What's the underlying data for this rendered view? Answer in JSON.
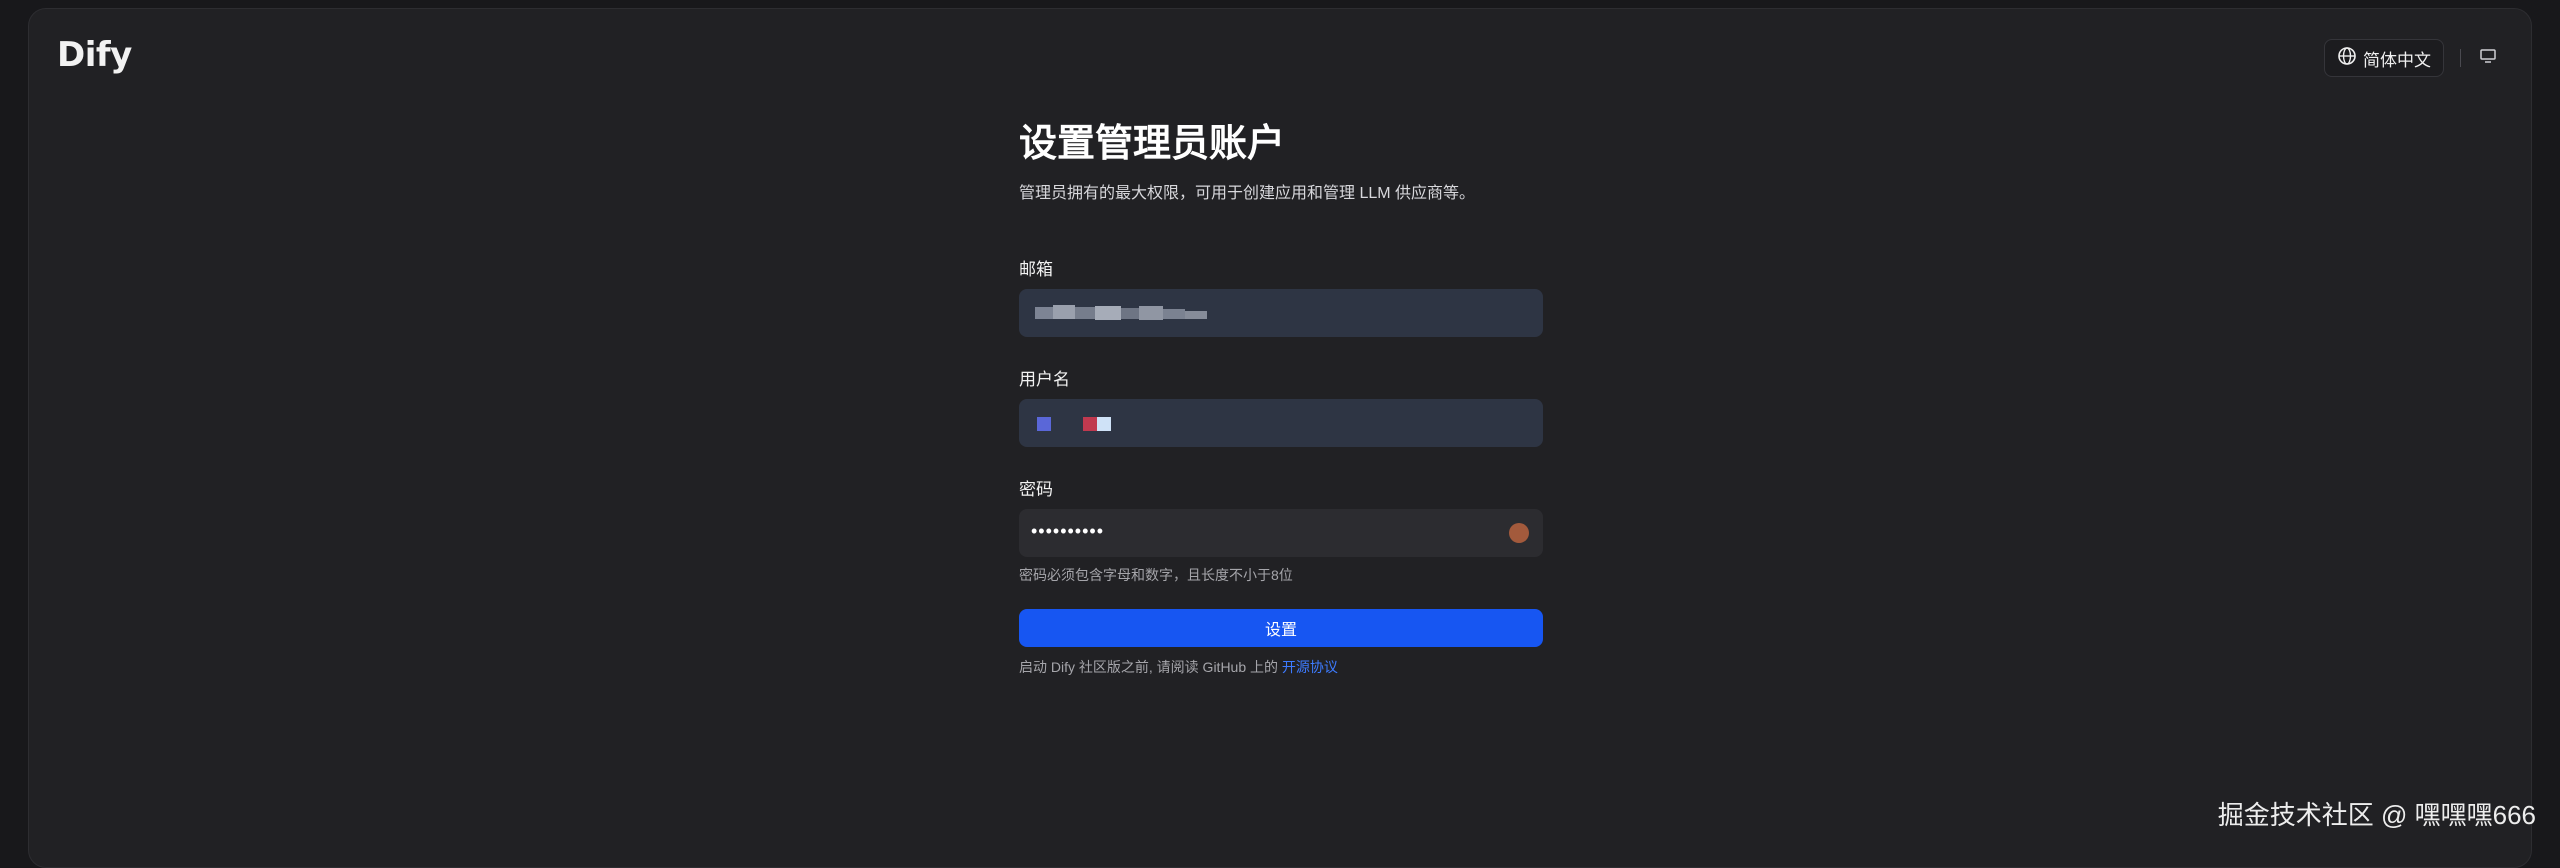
{
  "app": {
    "logo_text": "Dify"
  },
  "header": {
    "language_label": "简体中文",
    "language_icon": "globe-icon",
    "theme_icon": "monitor-icon"
  },
  "form": {
    "title": "设置管理员账户",
    "subtitle": "管理员拥有的最大权限，可用于创建应用和管理 LLM 供应商等。",
    "email_label": "邮箱",
    "username_label": "用户名",
    "password_label": "密码",
    "password_value": "••••••••••",
    "password_hint": "密码必须包含字母和数字，且长度不小于8位",
    "submit_label": "设置",
    "legal_text": "启动 Dify 社区版之前, 请阅读 GitHub 上的 ",
    "legal_link": "开源协议"
  },
  "watermark": "掘金技术社区 @ 嘿嘿嘿666",
  "colors": {
    "background": "#18181b",
    "panel": "#212124",
    "primary_button": "#1756f2",
    "input_bg": "#2e3544",
    "link": "#3d7bff"
  }
}
